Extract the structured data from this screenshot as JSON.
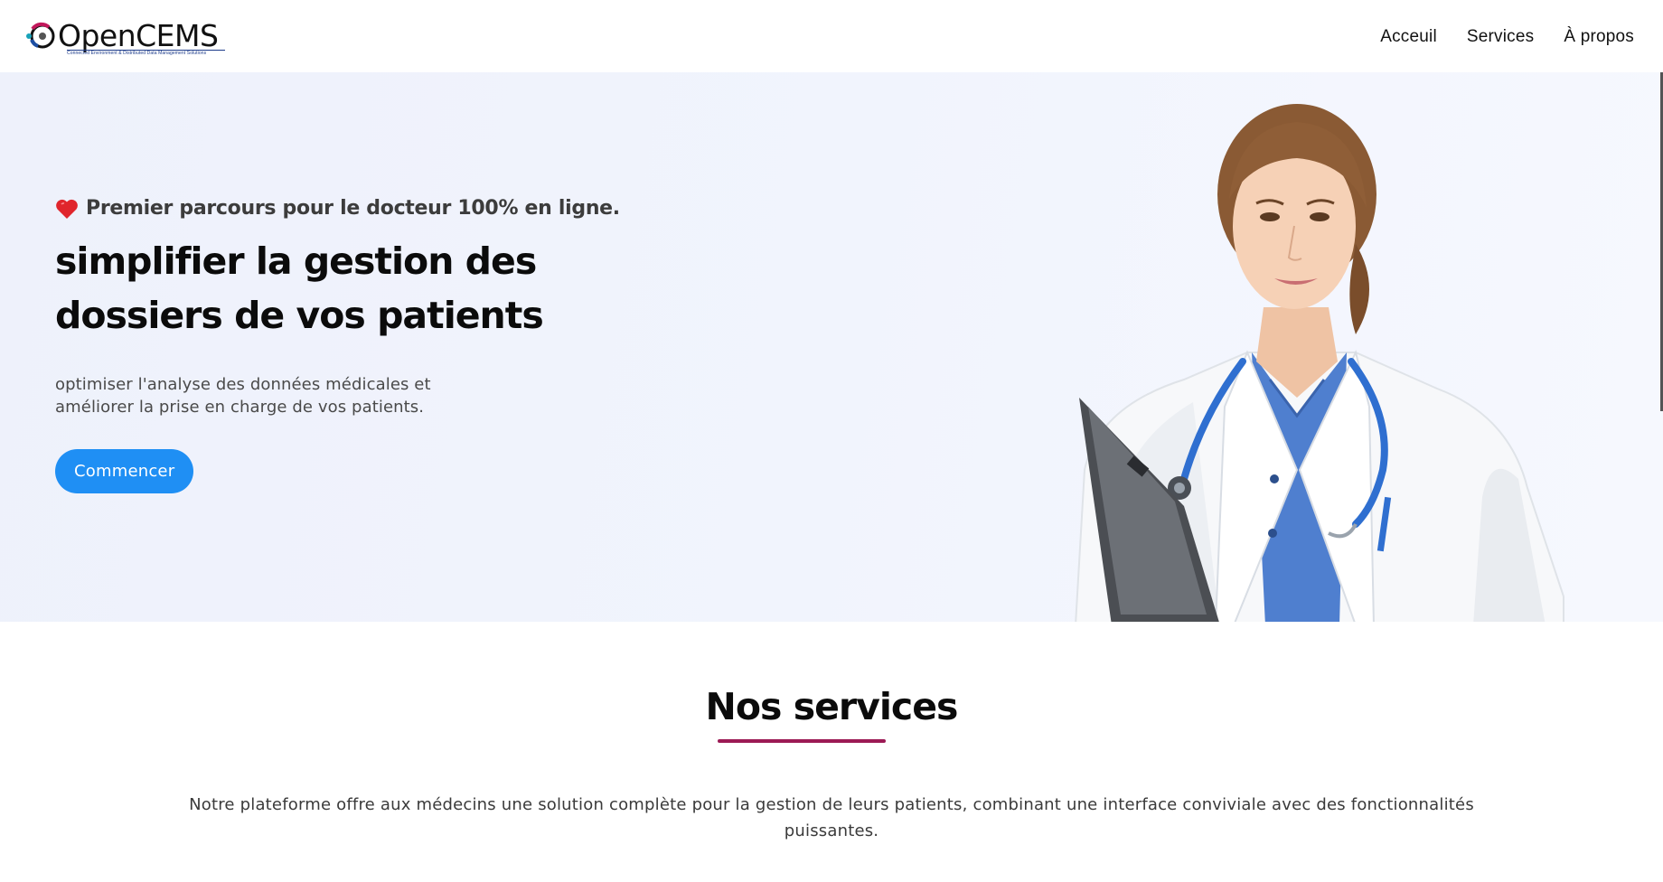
{
  "brand": {
    "name": "OpenCEMS",
    "tagline": "Connected Environment & Distributed Data Management Solutions"
  },
  "nav": {
    "items": [
      {
        "label": "Acceuil"
      },
      {
        "label": "Services"
      },
      {
        "label": "À propos"
      }
    ]
  },
  "hero": {
    "eyebrow": "Premier parcours pour le docteur 100% en ligne.",
    "eyebrow_icon": "heart-icon",
    "headline": "simplifier la gestion des dossiers de vos patients",
    "subtext": "optimiser l'analyse des données médicales et améliorer la prise en charge de vos patients.",
    "cta_label": "Commencer",
    "image_subject": "doctor-photo"
  },
  "services": {
    "title": "Nos services",
    "description": "Notre plateforme offre aux médecins une solution complète pour la gestion de leurs patients, combinant une interface conviviale avec des fonctionnalités puissantes."
  },
  "colors": {
    "accent": "#1f8ff4",
    "underline": "#9c1a55",
    "hero_bg": "#eef1fb",
    "heart": "#e0252c"
  }
}
